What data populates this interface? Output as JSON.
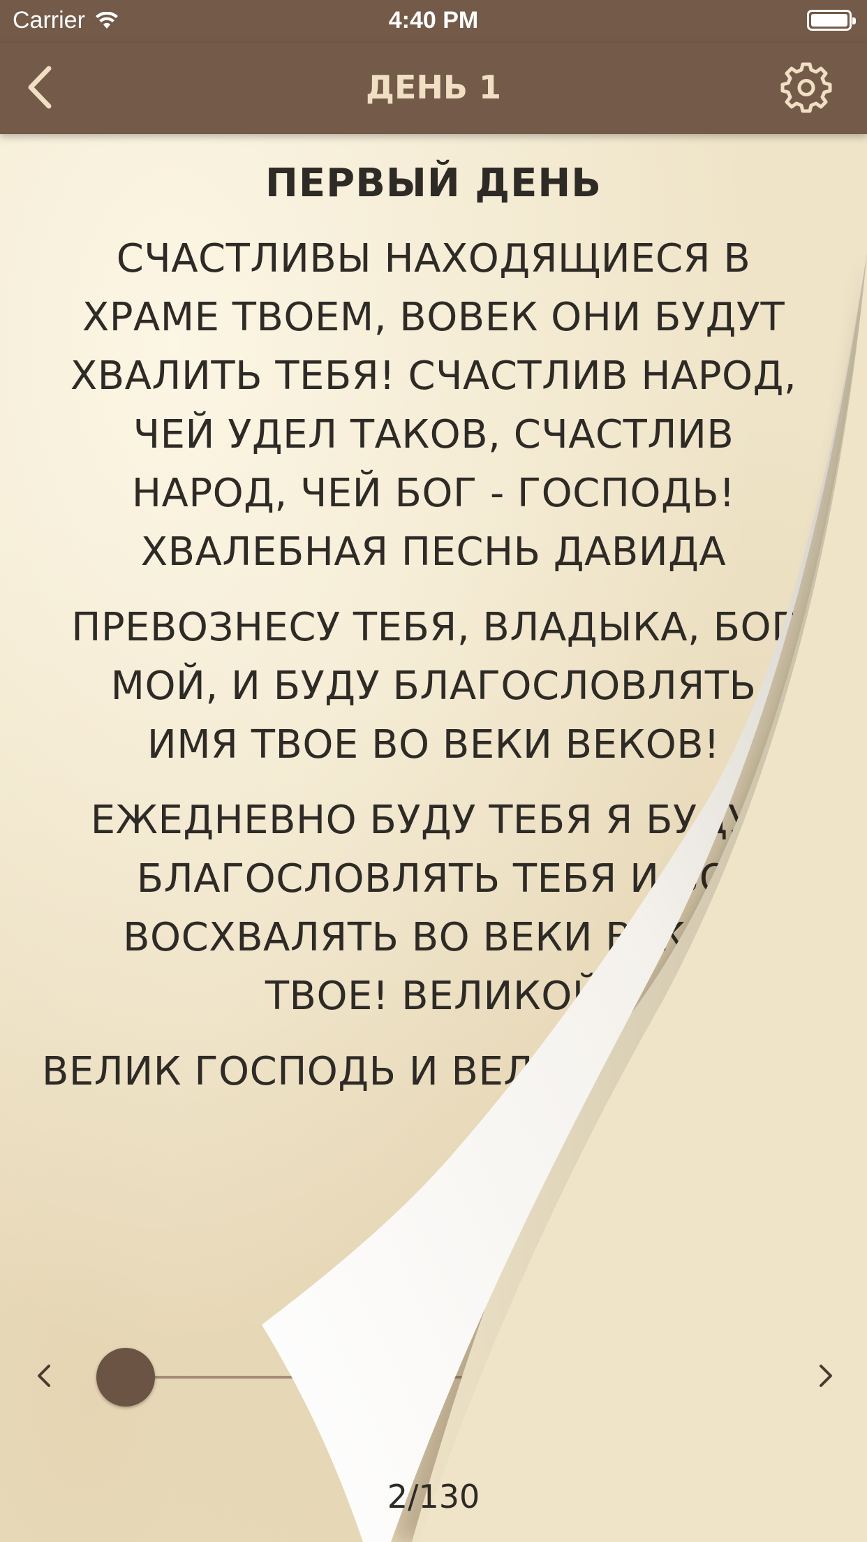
{
  "status_bar": {
    "carrier": "Carrier",
    "time": "4:40 PM",
    "icons": [
      "wifi-icon",
      "battery-icon"
    ]
  },
  "nav": {
    "title": "ДЕНЬ 1",
    "back_icon": "chevron-left-icon",
    "settings_icon": "gear-icon"
  },
  "content": {
    "heading": "ПЕРВЫЙ ДЕНЬ",
    "paragraph1": [
      "СЧАСТЛИВЫ НАХОДЯЩИЕСЯ В",
      "ХРАМЕ ТВОЕМ, ВОВЕК ОНИ БУДУТ",
      "ХВАЛИТЬ ТЕБЯ! СЧАСТЛИВ НАРОД,",
      "ЧЕЙ УДЕЛ ТАКОВ, СЧАСТЛИВ",
      "НАРОД, ЧЕЙ БОГ - ГОСПОДЬ!",
      "ХВАЛЕБНАЯ ПЕСНЬ ДАВИДА"
    ],
    "paragraph2": [
      "ПРЕВОЗНЕСУ ТЕБЯ, ВЛАДЫКА, БОГ",
      "МОЙ, И БУДУ БЛАГОСЛОВЛЯТЬ",
      "ИМЯ ТВОЕ ВО ВЕКИ ВЕКОВ!"
    ],
    "paragraph3": [
      "ЕЖЕДНЕВНО БУДУ ТЕБЯ Я БУДУТ",
      "БЛАГОСЛОВЛЯТЬ ТЕБЯ И ВО",
      "ВОСХВАЛЯТЬ ВО ВЕКИ ВЕКОВ",
      "ТВОЕ! ВЕЛИКОЙ"
    ],
    "paragraph4": [
      "ВЕЛИК ГОСПОДЬ И ВЕЛИКОЙ БУДУТ ОНИ"
    ]
  },
  "reader": {
    "prev_icon": "chevron-left-icon",
    "next_icon": "chevron-right-icon",
    "slider_position": 0.0,
    "page_counter": "2/130"
  },
  "colors": {
    "bar": "#735a49",
    "nav_title": "#f1dfc4",
    "parchment": "#efe4c8",
    "text": "#2e2a26",
    "slider_thumb": "#6b5444"
  }
}
